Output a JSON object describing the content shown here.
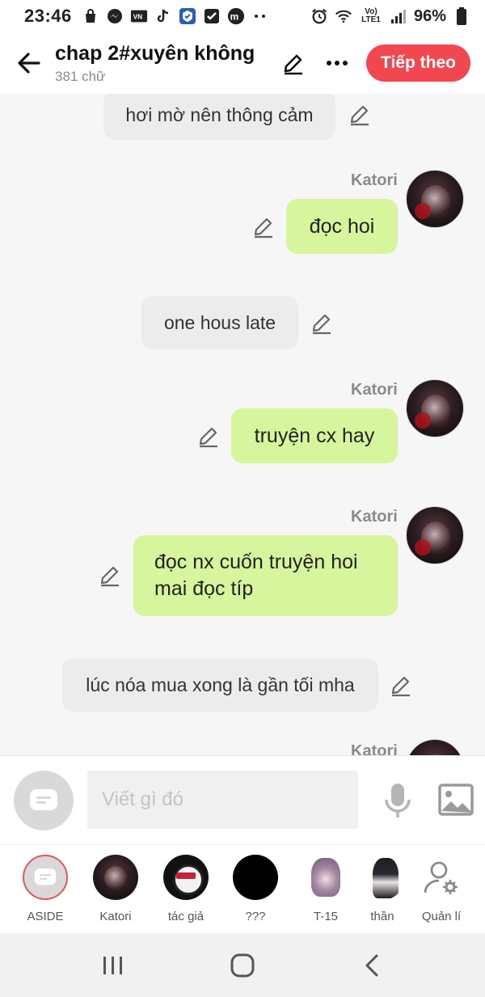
{
  "status_bar": {
    "time": "23:46",
    "battery": "96%",
    "network_label": "LTE1"
  },
  "header": {
    "title": "chap 2#xuyên không",
    "word_count": "381 chữ",
    "next_label": "Tiếp theo"
  },
  "messages": [
    {
      "type": "narration",
      "text": "hơi mờ nên thông cảm"
    },
    {
      "type": "character",
      "sender": "Katori",
      "text": "đọc hoi"
    },
    {
      "type": "narration",
      "text": "one hous late"
    },
    {
      "type": "character",
      "sender": "Katori",
      "text": "truyện cx hay"
    },
    {
      "type": "character",
      "sender": "Katori",
      "text_lines": [
        "đọc nx cuốn truyện hoi",
        "mai đọc típ"
      ]
    },
    {
      "type": "narration",
      "text": "lúc nóa mua xong là gần tối mha"
    },
    {
      "type": "character",
      "sender": "Katori"
    }
  ],
  "input": {
    "placeholder": "Viết gì đó"
  },
  "characters": [
    {
      "label": "ASIDE"
    },
    {
      "label": "Katori"
    },
    {
      "label": "tác giả"
    },
    {
      "label": "???"
    },
    {
      "label": "T-15"
    },
    {
      "label": "thần"
    },
    {
      "label": "Quản lí"
    }
  ],
  "colors": {
    "accent": "#f2474f",
    "character_bubble": "#d7f59c",
    "narration_bubble": "#ececec",
    "background": "#f6f6f6"
  }
}
